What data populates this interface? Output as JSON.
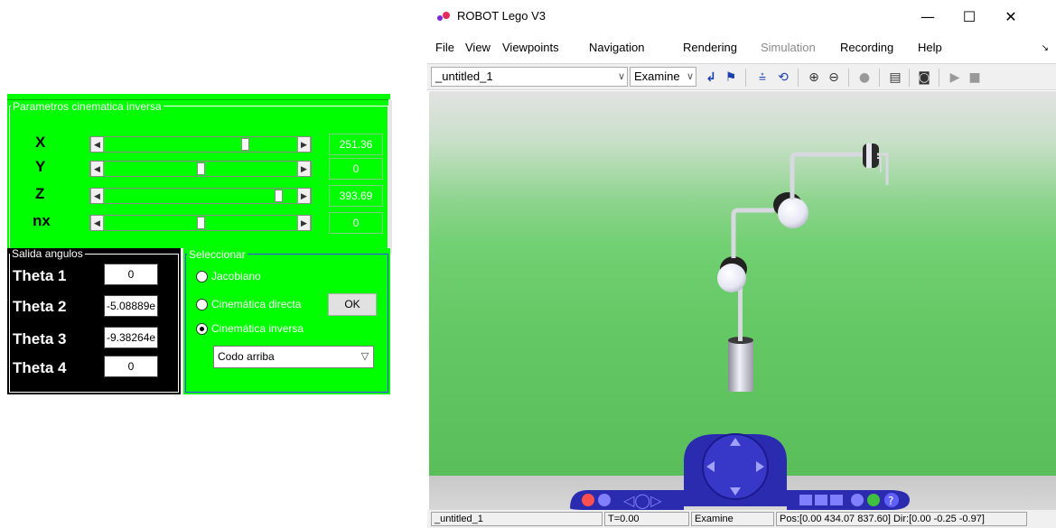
{
  "gui": {
    "ik_panel": {
      "title": "Parametros cinematica inversa",
      "rows": [
        {
          "label": "X",
          "value": "251.36",
          "position": 0.74
        },
        {
          "label": "Y",
          "value": "0",
          "position": 0.5
        },
        {
          "label": "Z",
          "value": "393.69",
          "position": 0.92
        },
        {
          "label": "nx",
          "value": "0",
          "position": 0.5
        }
      ]
    },
    "out_panel": {
      "title": "Salida angulos",
      "rows": [
        {
          "label": "Theta 1",
          "value": "0"
        },
        {
          "label": "Theta 2",
          "value": "-5.08889e"
        },
        {
          "label": "Theta 3",
          "value": "-9.38264e"
        },
        {
          "label": "Theta 4",
          "value": "0"
        }
      ]
    },
    "select_panel": {
      "title": "Seleccionar",
      "options": [
        {
          "label": "Jacobiano",
          "selected": false
        },
        {
          "label": "Cinemática directa",
          "selected": false
        },
        {
          "label": "Cinemática inversa",
          "selected": true
        }
      ],
      "ok_label": "OK",
      "dropdown_value": "Codo arriba"
    }
  },
  "viewer": {
    "title": "ROBOT Lego V3",
    "window_buttons": {
      "minimize": "—",
      "maximize": "☐",
      "close": "✕"
    },
    "menu": [
      {
        "label": "File",
        "disabled": false
      },
      {
        "label": "View",
        "disabled": false
      },
      {
        "label": "Viewpoints",
        "disabled": false
      },
      {
        "label": "Navigation",
        "disabled": false
      },
      {
        "label": "Rendering",
        "disabled": false
      },
      {
        "label": "Simulation",
        "disabled": true
      },
      {
        "label": "Recording",
        "disabled": false
      },
      {
        "label": "Help",
        "disabled": false
      }
    ],
    "toolbar": {
      "world_combo": "_untitled_1",
      "mode_combo": "Examine"
    },
    "status": {
      "world": "_untitled_1",
      "time": "T=0.00",
      "mode": "Examine",
      "pos_dir": "Pos:[0.00 434.07 837.60] Dir:[0.00 -0.25 -0.97]"
    }
  },
  "colors": {
    "panel_green": "#00ff00",
    "panel_black": "#000000",
    "select_border": "#4040ff"
  }
}
